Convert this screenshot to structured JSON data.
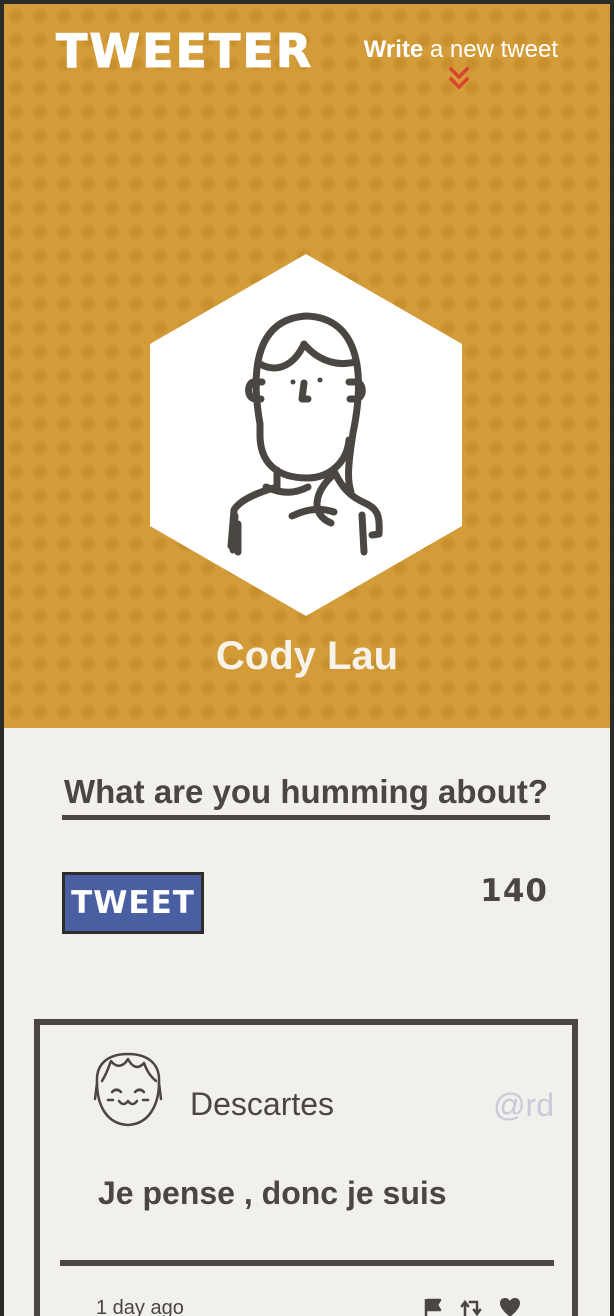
{
  "header": {
    "brand": "TWEETER",
    "write_link": {
      "strong": "Write",
      "rest": " a new tweet"
    }
  },
  "profile": {
    "name": "Cody Lau",
    "avatar_icon": "user-avatar-icon"
  },
  "compose": {
    "placeholder": "What are you humming about?",
    "value": "",
    "button_label": "TWEET",
    "char_count": "140"
  },
  "tweets": [
    {
      "author": "Descartes",
      "handle": "@rd",
      "text": "Je pense , donc je suis",
      "timestamp": "1 day ago",
      "actions": [
        "flag-icon",
        "retweet-icon",
        "heart-icon"
      ]
    }
  ],
  "colors": {
    "hero": "#d39c39",
    "page": "#f1f0ec",
    "text": "#4a4743",
    "button": "#4a5ea2",
    "accent": "#d9442f"
  }
}
